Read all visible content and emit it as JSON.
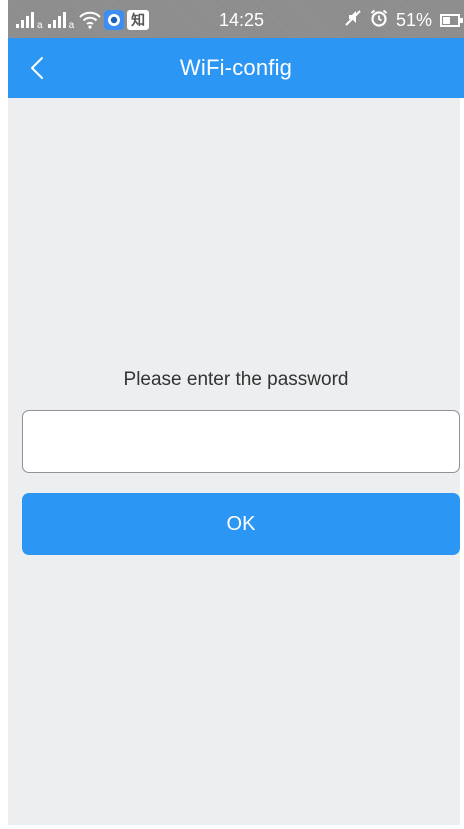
{
  "status_bar": {
    "sim1_signal_icon": "signal-bars-icon",
    "sim1_letter": "a",
    "sim2_signal_icon": "signal-bars-icon",
    "sim2_letter": "a",
    "wifi_icon": "wifi-icon",
    "app1_icon": "blue-app-icon",
    "app2_icon": "zhihu-app-icon",
    "app2_glyph": "知",
    "time": "14:25",
    "mute_icon": "mute-icon",
    "alarm_icon": "alarm-clock-icon",
    "battery_percent": "51%",
    "battery_level": 0.51,
    "background_color": "#8e8e8e"
  },
  "app_bar": {
    "back_icon": "chevron-left-icon",
    "title": "WiFi-config",
    "background_color": "#2c96f5"
  },
  "form": {
    "prompt": "Please enter the password",
    "password_value": "",
    "password_placeholder": "",
    "ok_label": "OK",
    "button_color": "#2c96f5"
  },
  "page": {
    "background_color": "#eceef0"
  }
}
